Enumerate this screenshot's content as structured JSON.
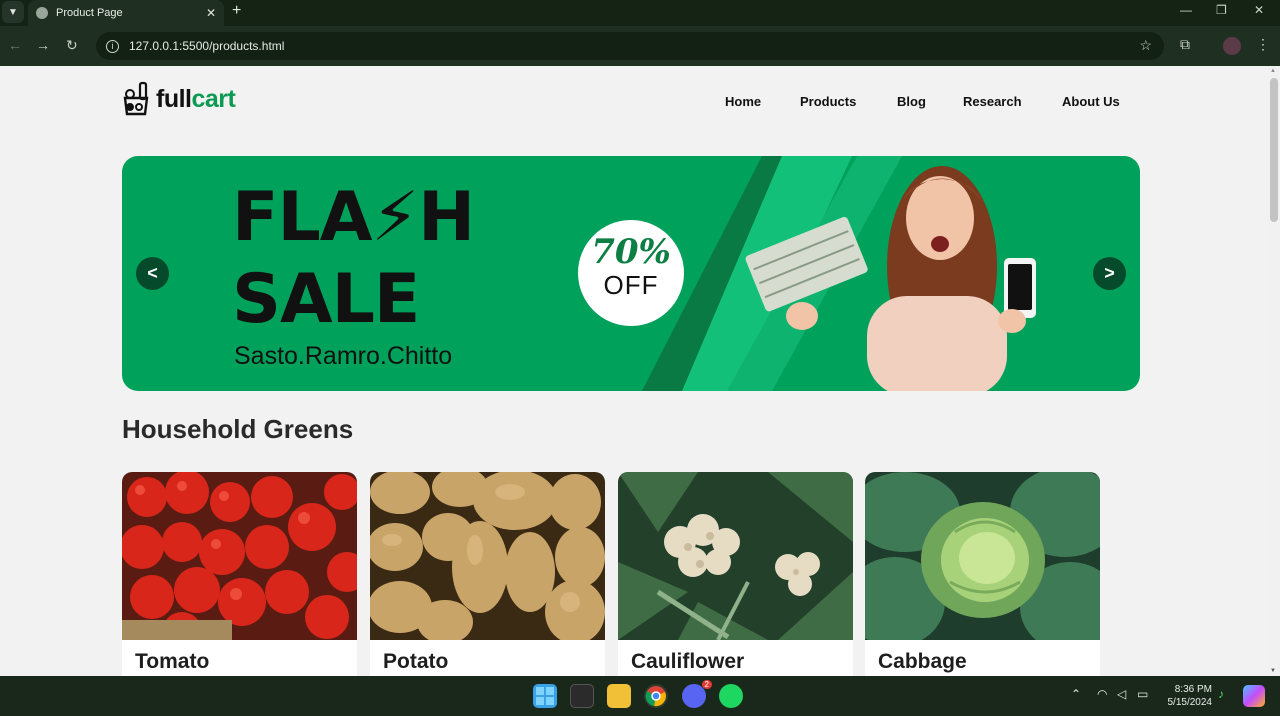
{
  "browser": {
    "tab_title": "Product Page",
    "tab_close": "✕",
    "new_tab": "+",
    "url": "127.0.0.1:5500/products.html",
    "minimize": "—",
    "maximize": "❐",
    "close": "✕"
  },
  "site": {
    "logo_full": "full",
    "logo_cart": "cart",
    "nav": [
      "Home",
      "Products",
      "Blog",
      "Research",
      "About Us"
    ]
  },
  "banner": {
    "prev_label": "<",
    "next_label": ">",
    "line1": "FLA⚡H",
    "line2": "SALE",
    "tagline": "Sasto.Ramro.Chitto",
    "discount_percent": "70%",
    "discount_off": "OFF",
    "color_bg": "#00a15a",
    "color_stripe": "#13c07a",
    "color_dark": "#054a2a"
  },
  "section": {
    "title": "Household Greens"
  },
  "products": [
    {
      "name": "Tomato",
      "icon": "tomato-image"
    },
    {
      "name": "Potato",
      "icon": "potato-image"
    },
    {
      "name": "Cauliflower",
      "icon": "cauliflower-image"
    },
    {
      "name": "Cabbage",
      "icon": "cabbage-image"
    }
  ],
  "taskbar": {
    "time": "8:36 PM",
    "date": "5/15/2024",
    "discord_badge": "2"
  }
}
